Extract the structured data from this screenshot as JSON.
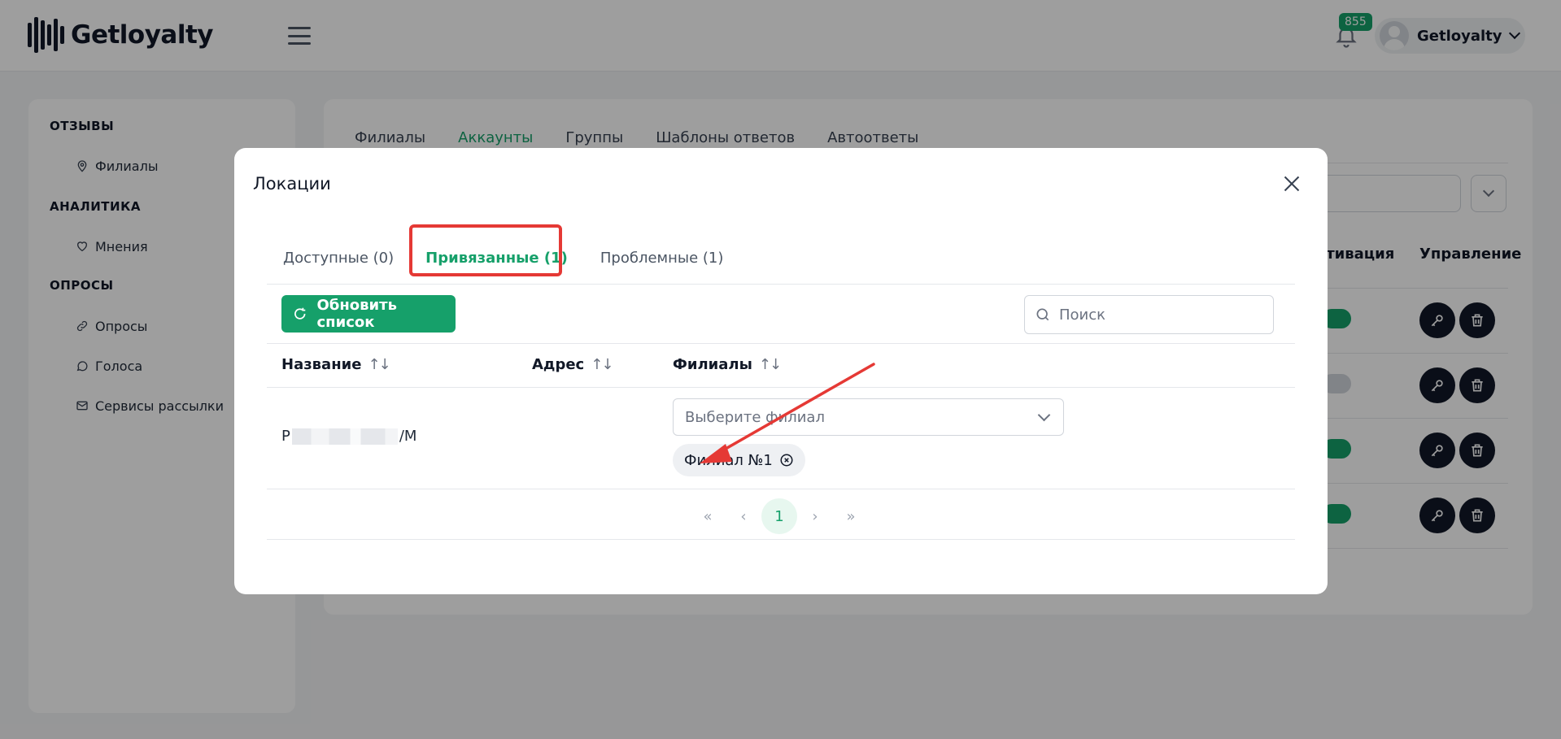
{
  "header": {
    "logo_text": "Getloyalty",
    "notification_count": "855",
    "user_name": "Getloyalty"
  },
  "sidebar": {
    "sections": [
      {
        "title": "ОТЗЫВЫ",
        "items": [
          {
            "label": "Филиалы",
            "icon": "map-pin-icon"
          }
        ]
      },
      {
        "title": "АНАЛИТИКА",
        "items": [
          {
            "label": "Мнения",
            "icon": "heart-icon"
          }
        ]
      },
      {
        "title": "ОПРОСЫ",
        "items": [
          {
            "label": "Опросы",
            "icon": "link-icon"
          },
          {
            "label": "Голоса",
            "icon": "chat-bubble-icon"
          },
          {
            "label": "Сервисы рассылки",
            "icon": "mail-icon"
          }
        ]
      }
    ]
  },
  "content": {
    "tabs": [
      "Филиалы",
      "Аккаунты",
      "Группы",
      "Шаблоны ответов",
      "Автоответы"
    ],
    "active_tab": "Аккаунты",
    "columns": {
      "activation": "ктивация",
      "management": "Управление"
    }
  },
  "modal": {
    "title": "Локации",
    "tabs": [
      "Доступные (0)",
      "Привязанные (1)",
      "Проблемные (1)"
    ],
    "active_tab": "Привязанные (1)",
    "refresh_label": "Обновить список",
    "search_placeholder": "Поиск",
    "columns": {
      "name": "Название",
      "address": "Адрес",
      "branches": "Филиалы"
    },
    "row": {
      "name_prefix": "Р",
      "name_suffix": "/М",
      "branch_placeholder": "Выберите филиал",
      "branch_chip": "Филиал №1"
    },
    "pagination": {
      "first": "«",
      "prev": "‹",
      "current": "1",
      "next": "›",
      "last": "»"
    }
  },
  "colors": {
    "accent": "#16a06a",
    "highlight": "#e53935",
    "dark": "#111827"
  }
}
